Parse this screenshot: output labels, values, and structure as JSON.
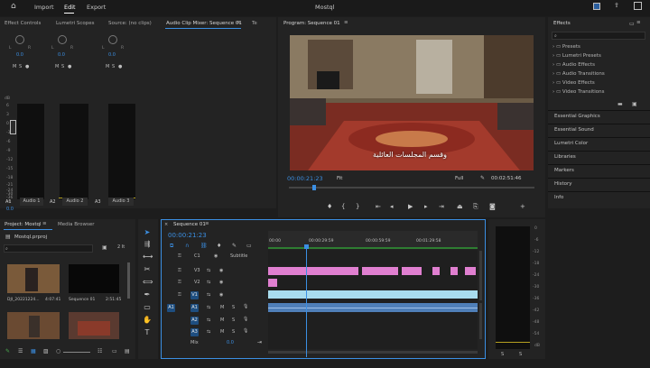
{
  "topbar": {
    "home_icon": "home-icon",
    "import": "Import",
    "edit": "Edit",
    "export": "Export",
    "title": "Mostql"
  },
  "tabs_left": [
    {
      "label": "Effect Controls"
    },
    {
      "label": "Lumetri Scopes"
    },
    {
      "label": "Source: (no clips)"
    },
    {
      "label": "Audio Clip Mixer: Sequence 01"
    },
    {
      "label": "Te"
    }
  ],
  "mixer": {
    "channels": [
      {
        "pan": "L",
        "pan2": "R",
        "value": "0.0",
        "track": "A1",
        "name": "Audio 1"
      },
      {
        "pan": "L",
        "pan2": "R",
        "value": "0.0",
        "track": "A2",
        "name": "Audio 2"
      },
      {
        "pan": "L",
        "pan2": "R",
        "value": "0.0",
        "track": "A3",
        "name": "Audio 3"
      }
    ],
    "db_label": "dB",
    "scale": [
      "6",
      "3",
      "0",
      "-3",
      "-6",
      "-9",
      "-12",
      "-15",
      "-18",
      "-21",
      "-24",
      "-30",
      "-36",
      "-∞"
    ],
    "msr": [
      "M",
      "S",
      "R"
    ],
    "master_value": "0.0"
  },
  "program": {
    "title": "Program: Sequence 01",
    "caption": "وقسم المجلسات العائلية",
    "timecode": "00:00:21:23",
    "fit": "Fit",
    "quality": "Full",
    "duration": "00:02:51:46"
  },
  "effects": {
    "title": "Effects",
    "search_placeholder": "",
    "folders": [
      "Presets",
      "Lumetri Presets",
      "Audio Effects",
      "Audio Transitions",
      "Video Effects",
      "Video Transitions"
    ],
    "sections": [
      "Essential Graphics",
      "Essential Sound",
      "Lumetri Color",
      "Libraries",
      "Markers",
      "History",
      "Info"
    ]
  },
  "project": {
    "tab1": "Project: Mostql",
    "tab2": "Media Browser",
    "file": "Mostql.prproj",
    "items": [
      {
        "name": "DJI_20221224...",
        "dur": "4:07:41"
      },
      {
        "name": "Sequence 01",
        "dur": "2:51:45"
      }
    ]
  },
  "timeline": {
    "tab": "Sequence 01",
    "timecode": "00:00:21:23",
    "ruler": [
      "00:00",
      "00:00:29:59",
      "00:00:59:59",
      "00:01:29:58"
    ],
    "subtitle": "Subtitle",
    "tracks": [
      "C1",
      "V3",
      "V2",
      "V1",
      "A1",
      "A2",
      "A3"
    ],
    "mix": "Mix",
    "mix_value": "0.0"
  },
  "master_meter": {
    "scale": [
      "0",
      "-6",
      "-12",
      "-18",
      "-24",
      "-30",
      "-36",
      "-42",
      "-48",
      "-54",
      "dB"
    ],
    "solo": [
      "S",
      "S"
    ]
  }
}
